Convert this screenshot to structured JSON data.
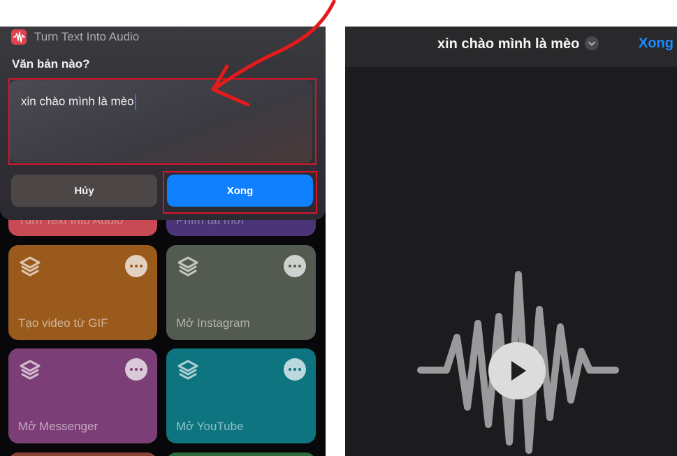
{
  "dialog": {
    "app_title": "Turn Text Into Audio",
    "prompt": "Văn bản nào?",
    "text_value": "xin chào mình là mèo",
    "cancel_label": "Hủy",
    "done_label": "Xong"
  },
  "shortcuts": {
    "row0": [
      "Turn Text Into Audio",
      "Phím tắt mới"
    ],
    "tiles": [
      {
        "label": "Tạo video từ GIF"
      },
      {
        "label": "Mở Instagram"
      },
      {
        "label": "Mở Messenger"
      },
      {
        "label": "Mở YouTube"
      }
    ]
  },
  "player": {
    "title": "xin chào mình là mèo",
    "done_label": "Xong"
  },
  "colors": {
    "accent_blue": "#1180ff",
    "highlight_red": "#d6152a",
    "tile_orange": "#9a5a1c",
    "tile_gray": "#535a4f",
    "tile_purple": "#7c3e76",
    "tile_teal": "#0d7480"
  },
  "icons": [
    "waveform-app-icon",
    "layers-icon",
    "more-icon",
    "chevron-down-icon",
    "play-icon",
    "waveform-icon"
  ]
}
